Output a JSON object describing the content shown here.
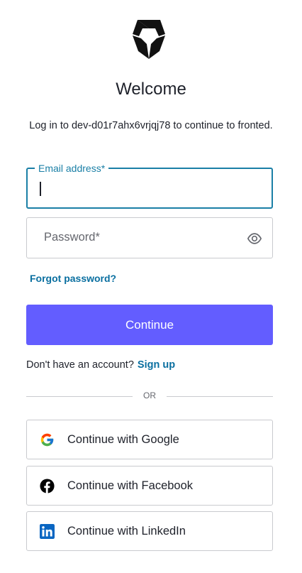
{
  "logo": {
    "icon": "shield-logo-icon"
  },
  "header": {
    "title": "Welcome",
    "subtitle": "Log in to dev-d01r7ahx6vrjqj78 to continue to fronted."
  },
  "form": {
    "email": {
      "label": "Email address*",
      "value": ""
    },
    "password": {
      "placeholder": "Password*",
      "toggle_icon": "eye-icon"
    },
    "forgot_password": "Forgot password?",
    "continue_label": "Continue"
  },
  "signup": {
    "prompt": "Don't have an account?",
    "link": "Sign up"
  },
  "divider": {
    "label": "OR"
  },
  "social": [
    {
      "icon": "google-icon",
      "label": "Continue with Google"
    },
    {
      "icon": "facebook-icon",
      "label": "Continue with Facebook"
    },
    {
      "icon": "linkedin-icon",
      "label": "Continue with LinkedIn"
    }
  ],
  "colors": {
    "accent": "#635dff",
    "link": "#0a6fa0",
    "focus": "#1a7fa6"
  }
}
